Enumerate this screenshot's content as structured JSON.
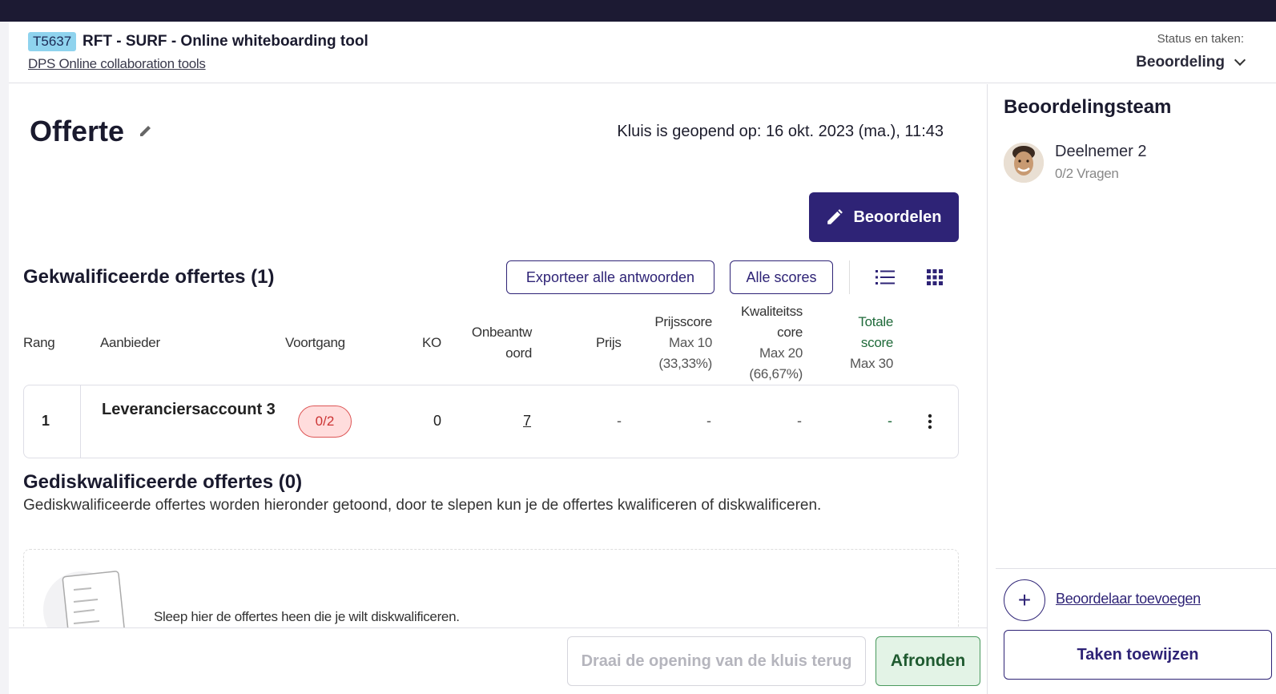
{
  "header": {
    "tender_code": "T5637",
    "tender_title": "RFT - SURF - Online whiteboarding tool",
    "tender_subtitle": "DPS Online collaboration tools",
    "status_label": "Status en taken:",
    "status_value": "Beoordeling"
  },
  "main": {
    "title": "Offerte",
    "opened_text": "Kluis is geopend op: 16 okt. 2023 (ma.), 11:43",
    "assess_button": "Beoordelen",
    "qualified_title": "Gekwalificeerde offertes (1)",
    "export_button": "Exporteer alle antwoorden",
    "scores_button": "Alle scores"
  },
  "table": {
    "headers": {
      "rank": "Rang",
      "supplier": "Aanbieder",
      "progress": "Voortgang",
      "ko": "KO",
      "unanswered_1": "Onbeantw",
      "unanswered_2": "oord",
      "price": "Prijs",
      "price_score": "Prijsscore",
      "price_score_max": "Max 10",
      "price_score_pct": "(33,33%)",
      "quality_1": "Kwaliteitss",
      "quality_2": "core",
      "quality_max": "Max 20",
      "quality_pct": "(66,67%)",
      "total_1": "Totale",
      "total_2": "score",
      "total_max": "Max 30"
    },
    "rows": [
      {
        "rank": "1",
        "supplier": "Leveranciersaccount 3",
        "progress": "0/2",
        "ko": "0",
        "unanswered": "7",
        "price": "-",
        "price_score": "-",
        "quality_score": "-",
        "total_score": "-"
      }
    ]
  },
  "disqualified": {
    "title": "Gediskwalificeerde offertes (0)",
    "description": "Gediskwalificeerde offertes worden hieronder getoond, door te slepen kun je de offertes kwalificeren of diskwalificeren.",
    "drop_text": "Sleep hier de offertes heen die je wilt diskwalificeren."
  },
  "footer": {
    "revert_button": "Draai de opening van de kluis terug",
    "finish_button": "Afronden"
  },
  "sidebar": {
    "team_title": "Beoordelingsteam",
    "members": [
      {
        "name": "Deelnemer 2",
        "questions": "0/2 Vragen"
      }
    ],
    "add_reviewer": "Beoordelaar toevoegen",
    "plus_symbol": "+",
    "assign_button": "Taken toewijzen"
  },
  "colors": {
    "primary": "#2e2376",
    "topbar": "#1c1a33",
    "badge_red": "#d55",
    "finish_green": "#4a9a5e"
  }
}
